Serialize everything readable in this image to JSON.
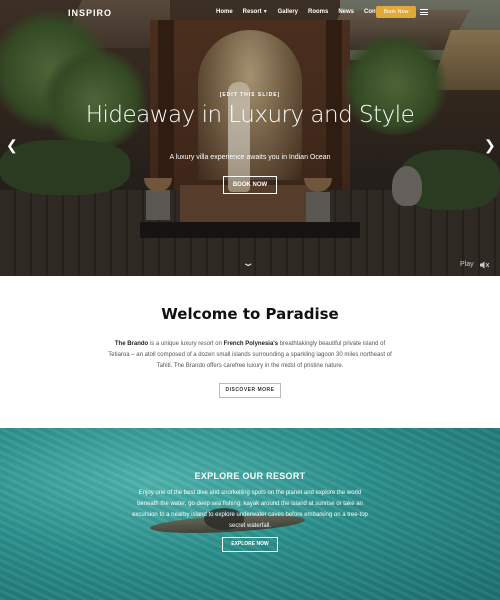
{
  "header": {
    "logo": "INSPIRO",
    "menu": [
      {
        "label": "Home"
      },
      {
        "label": "Resort",
        "dropdown": true
      },
      {
        "label": "Gallery"
      },
      {
        "label": "Rooms"
      },
      {
        "label": "News"
      },
      {
        "label": "Contact"
      }
    ],
    "book_button": "Book Now",
    "book_button_color": "#e0a93a",
    "menu_icon": "hamburger-icon"
  },
  "hero": {
    "edit_label": "[EDIT THIS SLIDE]",
    "title": "Hideaway in Luxury and Style",
    "subtitle": "A luxury villa experience awaits you in Indian Ocean",
    "button": "BOOK NOW",
    "prev_icon": "chevron-left-icon",
    "next_icon": "chevron-right-icon",
    "scroll_icon": "chevron-down-icon",
    "play_label": "Play",
    "volume_icon": "volume-icon"
  },
  "welcome": {
    "title": "Welcome to Paradise",
    "brand": "The Brando",
    "text_a": " is a unique luxury resort on ",
    "location": "French Polynesia's",
    "text_b": " breathtakingly beautiful private island of Tetiaroa – an atoll composed of a dozen small islands surrounding a sparkling lagoon 30 miles northeast of Tahiti. The Brando offers carefree luxury in the midst of pristine nature.",
    "button": "DISCOVER MORE"
  },
  "explore": {
    "title": "EXPLORE OUR RESORT",
    "text": "Enjoy one of the best dive and snorkelling spots on the planet and explore the world beneath the water, go deep sea fishing, kayak around the island at sunrise or take an excursion to a nearby island to explore underwater caves before embarking on a tree-top secret waterfall.",
    "button": "EXPLORE NOW",
    "accent": "#2a8e8a"
  }
}
